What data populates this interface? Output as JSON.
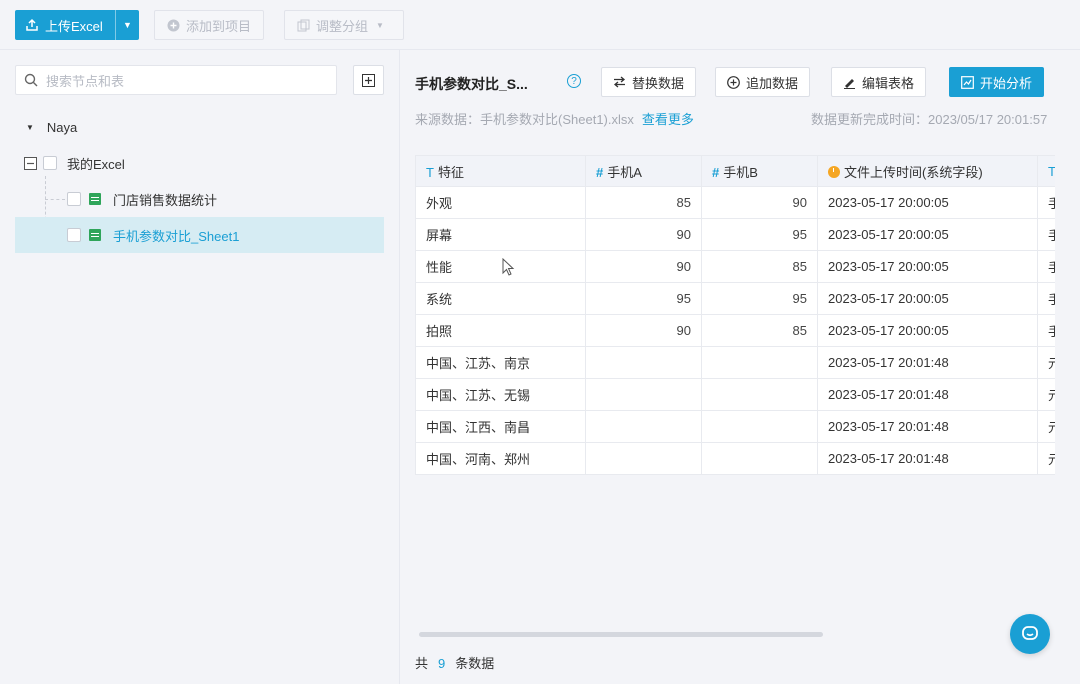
{
  "toolbar": {
    "upload_label": "上传Excel",
    "add_to_project_label": "添加到项目",
    "adjust_group_label": "调整分组"
  },
  "sidebar": {
    "search_placeholder": "搜索节点和表",
    "tree": {
      "root_label": "Naya",
      "group_label": "我的Excel",
      "items": [
        {
          "label": "门店销售数据统计",
          "selected": false
        },
        {
          "label": "手机参数对比_Sheet1",
          "selected": true
        }
      ]
    }
  },
  "main": {
    "title": "手机参数对比_S...",
    "buttons": {
      "replace": "替换数据",
      "append": "追加数据",
      "edit": "编辑表格",
      "analyze": "开始分析"
    },
    "source_label": "来源数据：",
    "source_file": "手机参数对比(Sheet1).xlsx",
    "view_more": "查看更多",
    "update_label": "数据更新完成时间：",
    "update_time": "2023/05/17 20:01:57",
    "table": {
      "columns": [
        {
          "label": "特征",
          "type": "text"
        },
        {
          "label": "手机A",
          "type": "number"
        },
        {
          "label": "手机B",
          "type": "number"
        },
        {
          "label": "文件上传时间(系统字段)",
          "type": "datetime"
        },
        {
          "label": "",
          "type": "text"
        }
      ],
      "rows": [
        [
          "外观",
          "85",
          "90",
          "2023-05-17 20:00:05",
          "手"
        ],
        [
          "屏幕",
          "90",
          "95",
          "2023-05-17 20:00:05",
          "手"
        ],
        [
          "性能",
          "90",
          "85",
          "2023-05-17 20:00:05",
          "手"
        ],
        [
          "系统",
          "95",
          "95",
          "2023-05-17 20:00:05",
          "手"
        ],
        [
          "拍照",
          "90",
          "85",
          "2023-05-17 20:00:05",
          "手"
        ],
        [
          "中国、江苏、南京",
          "",
          "",
          "2023-05-17 20:01:48",
          "元"
        ],
        [
          "中国、江苏、无锡",
          "",
          "",
          "2023-05-17 20:01:48",
          "元"
        ],
        [
          "中国、江西、南昌",
          "",
          "",
          "2023-05-17 20:01:48",
          "元"
        ],
        [
          "中国、河南、郑州",
          "",
          "",
          "2023-05-17 20:01:48",
          "元"
        ]
      ]
    },
    "footer": {
      "prefix": "共",
      "count": "9",
      "suffix": "条数据"
    }
  },
  "colors": {
    "accent": "#1a9fd4",
    "sheet_icon": "#2fa55a",
    "datetime_icon": "#f5a623"
  },
  "icons": [
    "upload-icon",
    "plus-circle-icon",
    "copy-icon",
    "search-icon",
    "plus-square-icon",
    "caret-down-icon",
    "collapse-icon",
    "sheet-icon",
    "help-icon",
    "swap-icon",
    "edit-icon",
    "chart-icon",
    "chat-icon"
  ]
}
